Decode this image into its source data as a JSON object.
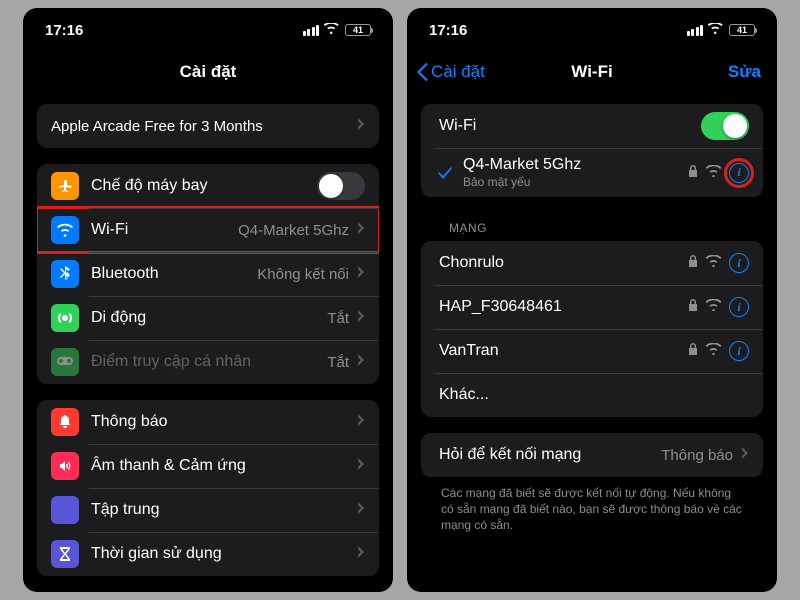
{
  "status": {
    "time": "17:16",
    "battery": "41"
  },
  "left": {
    "title": "Cài đặt",
    "promo": "Apple Arcade Free for 3 Months",
    "rows": {
      "airplane": "Chế độ máy bay",
      "wifi": "Wi-Fi",
      "wifi_value": "Q4-Market 5Ghz",
      "bluetooth": "Bluetooth",
      "bluetooth_value": "Không kết nối",
      "cellular": "Di động",
      "cellular_value": "Tắt",
      "hotspot": "Điểm truy cập cá nhân",
      "hotspot_value": "Tắt"
    },
    "group2": {
      "notifications": "Thông báo",
      "sounds": "Âm thanh & Cảm ứng",
      "focus": "Tập trung",
      "screentime": "Thời gian sử dụng"
    }
  },
  "right": {
    "back": "Cài đặt",
    "title": "Wi-Fi",
    "edit": "Sửa",
    "wifi_label": "Wi-Fi",
    "connected": {
      "ssid": "Q4-Market 5Ghz",
      "security": "Bảo mật yếu"
    },
    "section_networks": "MẠNG",
    "networks": [
      "Chonrulo",
      "HAP_F30648461",
      "VanTran"
    ],
    "other": "Khác...",
    "ask": {
      "label": "Hỏi để kết nối mạng",
      "value": "Thông báo"
    },
    "footer": "Các mạng đã biết sẽ được kết nối tự động. Nếu không có sẵn mạng đã biết nào, bạn sẽ được thông báo về các mạng có sẵn."
  }
}
